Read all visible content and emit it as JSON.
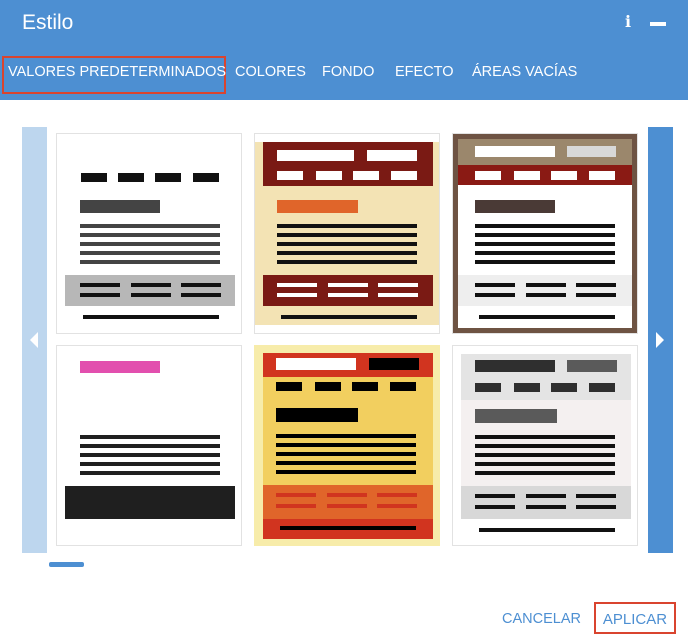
{
  "dialog": {
    "title": "Estilo",
    "info_icon": "info-icon",
    "minimize_icon": "minimize-icon"
  },
  "tabs": [
    {
      "label": "VALORES PREDETERMINADOS",
      "active": true
    },
    {
      "label": "COLORES",
      "active": false
    },
    {
      "label": "FONDO",
      "active": false
    },
    {
      "label": "EFECTO",
      "active": false
    },
    {
      "label": "ÁREAS VACÍAS",
      "active": false
    }
  ],
  "presets": [
    {
      "name": "blanco-gris",
      "colors": [
        "#ffffff",
        "#111111",
        "#444444",
        "#b7b7b7"
      ]
    },
    {
      "name": "burdeos-crema",
      "colors": [
        "#7a1a14",
        "#f3e3b4",
        "#e0652a",
        "#111111"
      ]
    },
    {
      "name": "marron-borde",
      "colors": [
        "#6e5343",
        "#8a1a14",
        "#4a3a36",
        "#ffffff"
      ]
    },
    {
      "name": "rosa-negro",
      "colors": [
        "#e24fae",
        "#1f1f1f",
        "#ffffff"
      ]
    },
    {
      "name": "amarillo-rojo",
      "colors": [
        "#f7ecaa",
        "#d1341f",
        "#f2cf5f",
        "#e0652a",
        "#000000"
      ]
    },
    {
      "name": "gris-claro",
      "colors": [
        "#e4e4e4",
        "#2f2f2f",
        "#5a5a5a",
        "#f4f0f0"
      ]
    }
  ],
  "pager": {
    "page": 1
  },
  "buttons": {
    "cancel": "CANCELAR",
    "apply": "APLICAR"
  },
  "accent_color": "#4d8fd2",
  "highlight_color": "#d9442f"
}
